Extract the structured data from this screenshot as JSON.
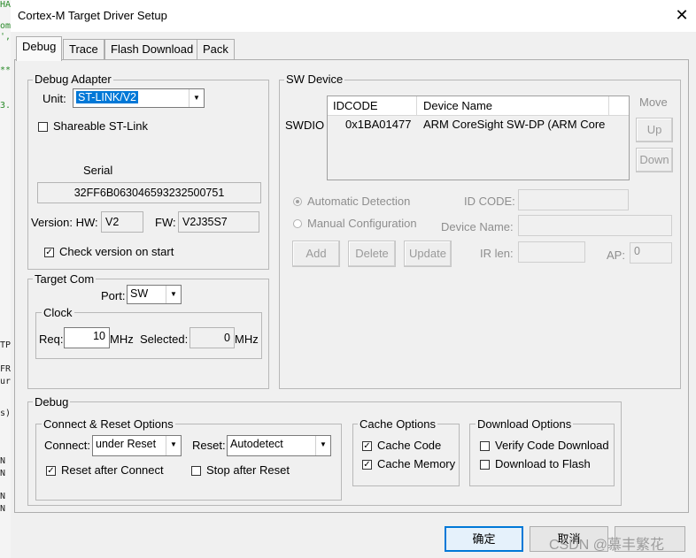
{
  "window": {
    "title": "Cortex-M Target Driver Setup",
    "close_glyph": "✕"
  },
  "background_fragments": [
    {
      "text": "HAL",
      "green": true
    },
    {
      "text": "om",
      "green": true
    },
    {
      "text": "',",
      "green": true
    },
    {
      "text": "**",
      "green": true
    },
    {
      "text": "3.",
      "green": true
    },
    {
      "text": "TP",
      "green": false
    },
    {
      "text": "FR",
      "green": false
    },
    {
      "text": "ur",
      "green": false
    },
    {
      "text": "s)",
      "green": false
    },
    {
      "text": "N",
      "green": false
    },
    {
      "text": "N",
      "green": false
    },
    {
      "text": "N",
      "green": false
    },
    {
      "text": "N",
      "green": false
    }
  ],
  "tabs": [
    "Debug",
    "Trace",
    "Flash Download",
    "Pack"
  ],
  "debug_adapter": {
    "legend": "Debug Adapter",
    "unit_label": "Unit:",
    "unit_value": "ST-LINK/V2",
    "shareable_label": "Shareable ST-Link",
    "shareable_checked": false,
    "serial_label": "Serial",
    "serial_value": "32FF6B063046593232500751",
    "version_label": "Version: HW:",
    "hw_value": "V2",
    "fw_label": "FW:",
    "fw_value": "V2J35S7",
    "check_version_label": "Check version on start",
    "check_version_checked": true
  },
  "target_com": {
    "legend": "Target Com",
    "port_label": "Port:",
    "port_value": "SW",
    "clock_legend": "Clock",
    "req_label": "Req:",
    "req_value": "10",
    "req_unit": "MHz",
    "selected_label": "Selected:",
    "selected_value": "0",
    "selected_unit": "MHz"
  },
  "sw_device": {
    "legend": "SW Device",
    "col_idcode": "IDCODE",
    "col_device_name": "Device Name",
    "row_label": "SWDIO",
    "row_idcode": "0x1BA01477",
    "row_device": "ARM CoreSight SW-DP (ARM Core",
    "move_label": "Move",
    "up_label": "Up",
    "down_label": "Down",
    "auto_detection": "Automatic Detection",
    "manual_config": "Manual Configuration",
    "id_code_label": "ID CODE:",
    "device_name_label": "Device Name:",
    "ir_len_label": "IR len:",
    "ap_label": "AP:",
    "ap_value": "0",
    "add_label": "Add",
    "delete_label": "Delete",
    "update_label": "Update"
  },
  "debug": {
    "legend": "Debug",
    "connect_reset": {
      "legend": "Connect & Reset Options",
      "connect_label": "Connect:",
      "connect_value": "under Reset",
      "reset_label": "Reset:",
      "reset_value": "Autodetect",
      "reset_after_connect": "Reset after Connect",
      "reset_after_connect_checked": true,
      "stop_after_reset": "Stop after Reset",
      "stop_after_reset_checked": false
    },
    "cache": {
      "legend": "Cache Options",
      "cache_code": "Cache Code",
      "cache_code_checked": true,
      "cache_memory": "Cache Memory",
      "cache_memory_checked": true
    },
    "download": {
      "legend": "Download Options",
      "verify": "Verify Code Download",
      "verify_checked": false,
      "download_flash": "Download to Flash",
      "download_flash_checked": false
    }
  },
  "footer": {
    "ok_label": "确定",
    "cancel_label": "取消",
    "watermark": "CSDN @慕丰繁花"
  }
}
